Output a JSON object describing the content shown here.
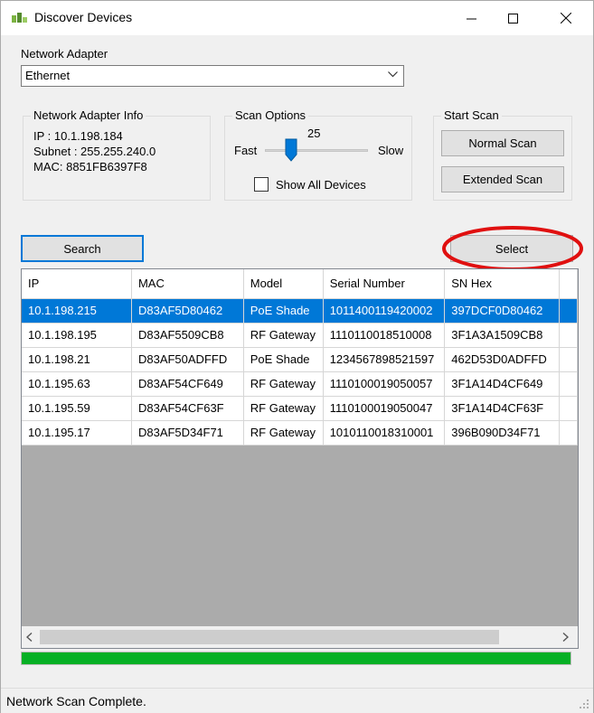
{
  "window": {
    "title": "Discover Devices"
  },
  "adapter": {
    "label": "Network Adapter",
    "selected": "Ethernet"
  },
  "adapter_info": {
    "legend": "Network Adapter Info",
    "ip": "IP : 10.1.198.184",
    "subnet": "Subnet : 255.255.240.0",
    "mac": "MAC: 8851FB6397F8"
  },
  "scan_options": {
    "legend": "Scan Options",
    "value": "25",
    "fast_label": "Fast",
    "slow_label": "Slow",
    "level_fraction": 0.25,
    "show_all_label": "Show All Devices",
    "show_all_checked": false
  },
  "start_scan": {
    "legend": "Start Scan",
    "normal_label": "Normal Scan",
    "extended_label": "Extended Scan"
  },
  "actions": {
    "search_label": "Search",
    "select_label": "Select"
  },
  "table": {
    "headers": [
      "IP",
      "MAC",
      "Model",
      "Serial Number",
      "SN Hex"
    ],
    "rows": [
      [
        "10.1.198.215",
        "D83AF5D80462",
        "PoE Shade",
        "1011400119420002",
        "397DCF0D80462"
      ],
      [
        "10.1.198.195",
        "D83AF5509CB8",
        "RF Gateway",
        "1110110018510008",
        "3F1A3A1509CB8"
      ],
      [
        "10.1.198.21",
        "D83AF50ADFFD",
        "PoE Shade",
        "1234567898521597",
        "462D53D0ADFFD"
      ],
      [
        "10.1.195.63",
        "D83AF54CF649",
        "RF Gateway",
        "1110100019050057",
        "3F1A14D4CF649"
      ],
      [
        "10.1.195.59",
        "D83AF54CF63F",
        "RF Gateway",
        "1110100019050047",
        "3F1A14D4CF63F"
      ],
      [
        "10.1.195.17",
        "D83AF5D34F71",
        "RF Gateway",
        "1010110018310001",
        "396B090D34F71"
      ]
    ],
    "selected_row": 0
  },
  "progress": {
    "fraction": 1.0
  },
  "status": {
    "text": "Network Scan Complete."
  },
  "colors": {
    "accent": "#0078d7",
    "progress": "#06b025",
    "highlight_ring": "#e01010"
  }
}
